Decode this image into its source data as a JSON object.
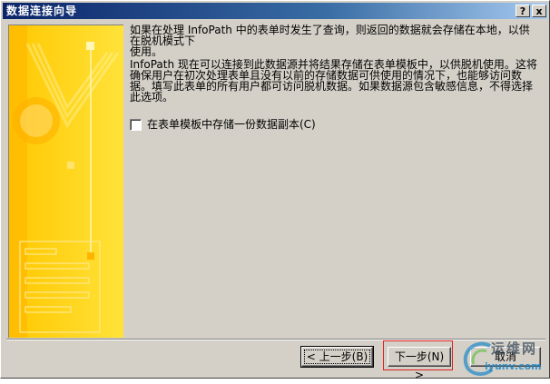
{
  "window": {
    "title": "数据连接向导",
    "help_label": "?",
    "close_label": "x"
  },
  "content": {
    "paragraph1": "如果在处理 InfoPath 中的表单时发生了查询，则返回的数据就会存储在本地，以供在脱机模式下\n使用。",
    "paragraph2": "InfoPath 现在可以连接到此数据源并将结果存储在表单模板中，以供脱机使用。这将确保用户在初次处理表单且没有以前的存储数据可供使用的情况下，也能够访问数据。填写此表单的所有用户都可访问脱机数据。如果数据源包含敏感信息，不得选择此选项。",
    "checkbox_label": "在表单模板中存储一份数据副本(C)",
    "checkbox_checked": false
  },
  "buttons": {
    "back": "< 上一步(B)",
    "next": "下一步(N) >",
    "cancel": "取消"
  },
  "watermark": {
    "top": "运维网",
    "bottom": "iyunv.com"
  },
  "colors": {
    "title_bar": "#0a246a",
    "dialog_bg": "#d4d0c8",
    "side_panel": "#ffd21a",
    "highlight": "#e02020"
  }
}
